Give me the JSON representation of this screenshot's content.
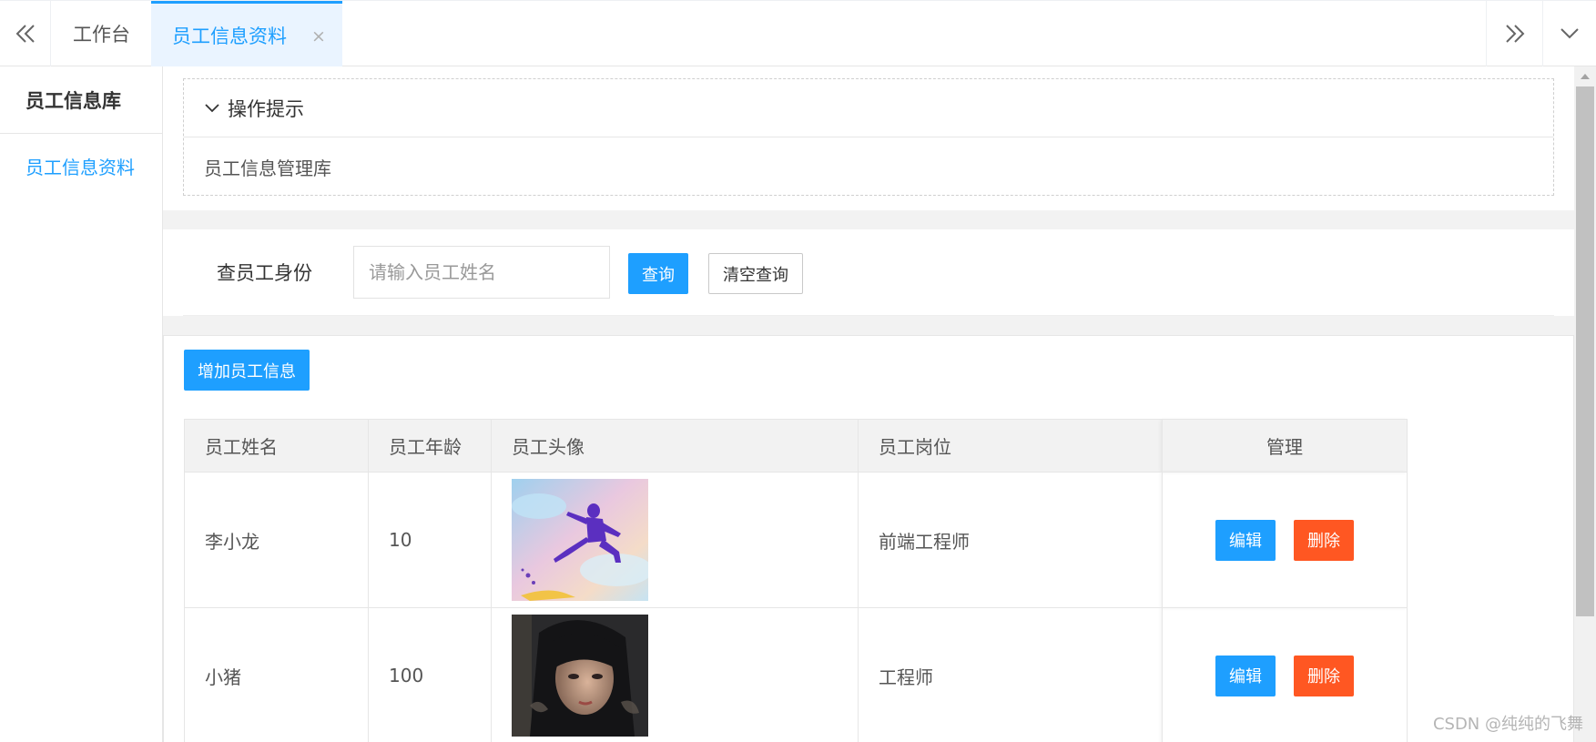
{
  "tabs": {
    "home_label": "工作台",
    "active_label": "员工信息资料",
    "close_glyph": "×"
  },
  "sidebar": {
    "title": "员工信息库",
    "items": [
      {
        "label": "员工信息资料"
      }
    ]
  },
  "tip": {
    "title": "操作提示",
    "body": "员工信息管理库"
  },
  "search": {
    "label": "查员工身份",
    "placeholder": "请输入员工姓名",
    "value": "",
    "query_button": "查询",
    "clear_button": "清空查询"
  },
  "toolbar": {
    "add_button": "增加员工信息"
  },
  "table": {
    "headers": [
      "员工姓名",
      "员工年龄",
      "员工头像",
      "员工岗位",
      "管理"
    ],
    "rows": [
      {
        "name": "李小龙",
        "age": "10",
        "position": "前端工程师",
        "avatar": "jumping-figure-avatar"
      },
      {
        "name": "小猪",
        "age": "100",
        "position": "工程师",
        "avatar": "dark-hair-portrait-avatar"
      }
    ],
    "edit_label": "编辑",
    "delete_label": "删除"
  },
  "colors": {
    "accent": "#1e9fff",
    "danger": "#ff5722"
  },
  "watermark": "CSDN @纯纯的飞舞"
}
